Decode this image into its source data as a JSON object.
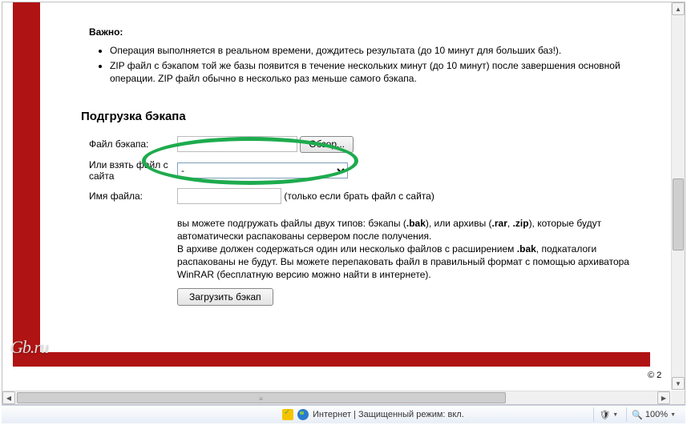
{
  "important_label": "Важно:",
  "notes": [
    "Операция выполняется в реальном времени, дождитесь результата (до 10 минут для больших баз!).",
    "ZIP файл с бэкапом той же базы появится в течение нескольких минут (до 10 минут) после завершения основной операции. ZIP файл обычно в несколько раз меньше самого бэкапа."
  ],
  "section_title": "Подгрузка бэкапа",
  "labels": {
    "file": "Файл бэкапа:",
    "or_from_site": "Или взять файл с сайта",
    "filename": "Имя файла:"
  },
  "browse_button": "Обзор...",
  "select_option": "-",
  "filename_hint": "(только если брать файл с сайта)",
  "description": "вы можете подгружать файлы двух типов: бэкапы (.bak), или архивы (.rar, .zip), которые будут автоматически распакованы сервером после получения.\nВ архиве должен содержаться один или несколько файлов с расширением .bak, подкаталоги распакованы не будут. Вы можете перепаковать файл в правильный формат с помощью архиватора WinRAR (бесплатную версию можно найти в интернете).",
  "submit_button": "Загрузить бэкап",
  "logo_text": "Gb.ru",
  "copyright": "© 2",
  "statusbar": {
    "zone": "Интернет | Защищенный режим: вкл.",
    "zoom": "100%"
  }
}
